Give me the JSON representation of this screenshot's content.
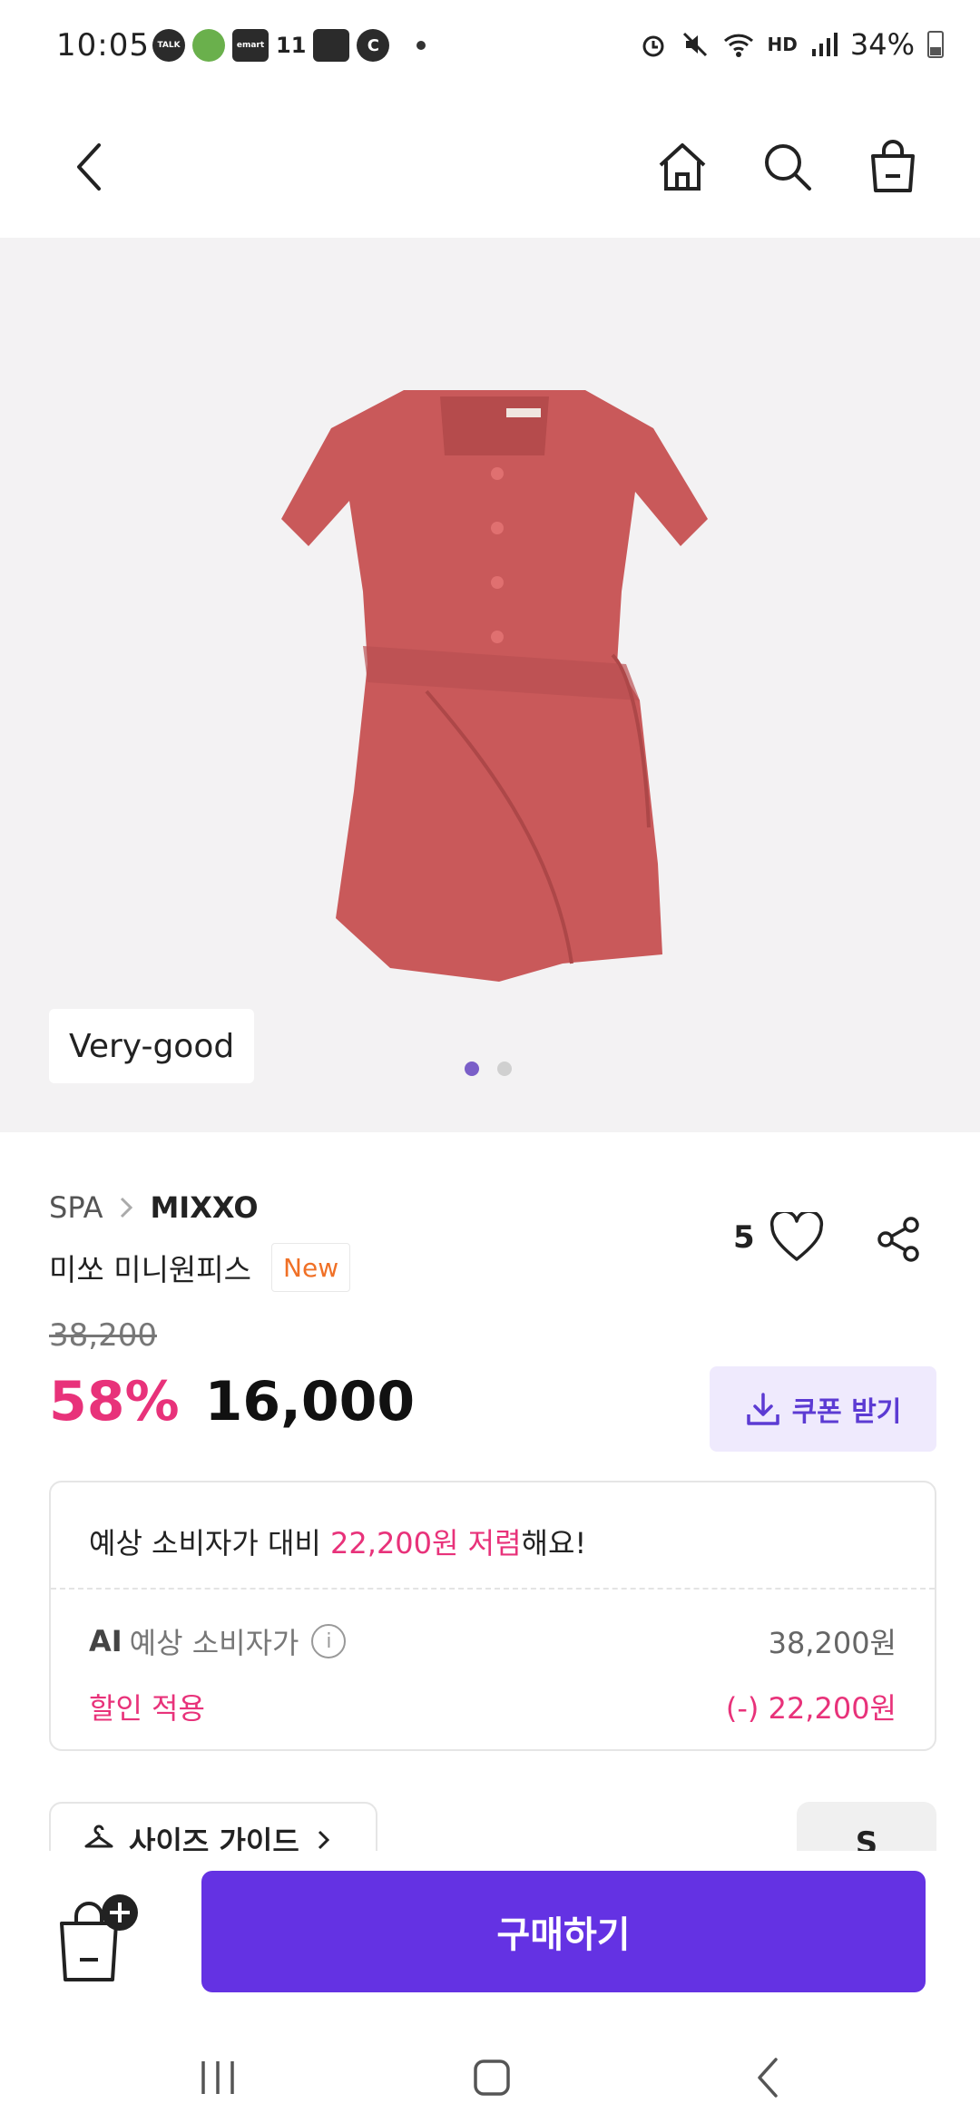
{
  "status_bar": {
    "time": "10:05",
    "left_icons": [
      "TALK",
      "",
      "emart",
      "11",
      "",
      "C"
    ],
    "battery": "34%",
    "hd_label": "HD"
  },
  "app_bar": {
    "icons": [
      "back-icon",
      "home-icon",
      "search-icon",
      "shopping-bag-icon"
    ]
  },
  "gallery": {
    "grade": "Very-good",
    "page_count": 2,
    "active_page": 1,
    "image_subject": "dress"
  },
  "product": {
    "category": "SPA",
    "brand": "MIXXO",
    "name": "미쏘 미니원피스",
    "badge": "New",
    "like_count": "5",
    "original_price": "38,200",
    "discount_rate": "58%",
    "sale_price": "16,000"
  },
  "coupon": {
    "label": "쿠폰 받기"
  },
  "savings": {
    "head_prefix": "예상 소비자가 대비 ",
    "head_highlight": "22,200원 저렴",
    "head_suffix": "해요!",
    "ai_label_strong": "AI",
    "ai_label": "예상 소비자가",
    "ai_value": "38,200원",
    "discount_label": "할인 적용",
    "discount_value": "(-) 22,200원"
  },
  "size": {
    "guide_label": "사이즈 가이드",
    "selected": "S"
  },
  "actions": {
    "buy_label": "구매하기"
  },
  "colors": {
    "accent": "#6432e3",
    "sale_pink": "#e8327a",
    "new_orange": "#f07026",
    "dress": "#c9595a"
  }
}
